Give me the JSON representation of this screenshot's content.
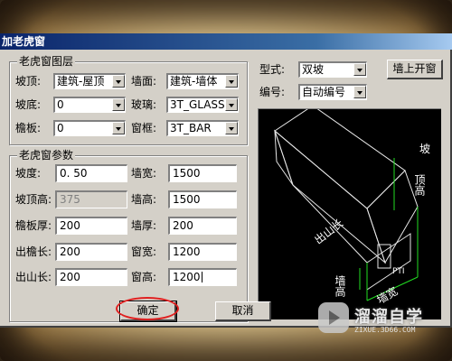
{
  "window": {
    "title": "加老虎窗"
  },
  "layers_group": {
    "title": "老虎窗图层",
    "rows": [
      {
        "left_label": "坡顶:",
        "left_value": "建筑-屋顶",
        "right_label": "墙面:",
        "right_value": "建筑-墙体"
      },
      {
        "left_label": "坡底:",
        "left_value": "0",
        "right_label": "玻璃:",
        "right_value": "3T_GLASS"
      },
      {
        "left_label": "檐板:",
        "left_value": "0",
        "right_label": "窗框:",
        "right_value": "3T_BAR"
      }
    ]
  },
  "params_group": {
    "title": "老虎窗参数",
    "rows": [
      {
        "left_label": "坡度:",
        "left_value": "0. 50",
        "right_label": "墙宽:",
        "right_value": "1500"
      },
      {
        "left_label": "坡顶高:",
        "left_value": "375",
        "right_label": "墙高:",
        "right_value": "1500"
      },
      {
        "left_label": "檐板厚:",
        "left_value": "200",
        "right_label": "墙厚:",
        "right_value": "200"
      },
      {
        "left_label": "出檐长:",
        "left_value": "200",
        "right_label": "窗宽:",
        "right_value": "1200"
      },
      {
        "left_label": "出山长:",
        "left_value": "200",
        "right_label": "窗高:",
        "right_value": "1200"
      }
    ]
  },
  "style": {
    "label": "型式:",
    "value": "双坡"
  },
  "number": {
    "label": "编号:",
    "value": "自动编号"
  },
  "wall_top_button": "墙上开窗",
  "preview": {
    "label_slope": "坡",
    "label_top_height": "顶高",
    "label_overhang": "出山长",
    "label_wall_height": "墙高",
    "label_wall_width": "墙宽",
    "label_window": "PTI"
  },
  "ok_button": "确定",
  "cancel_button": "取消",
  "watermark": {
    "title": "溜溜自学",
    "url": "ZIXUE.3D66.COM"
  },
  "colors": {
    "title_bar": "#0a246a",
    "dialog_bg": "#d4d0c8",
    "highlight": "#e02020",
    "dim_lines": "#22dd22"
  }
}
